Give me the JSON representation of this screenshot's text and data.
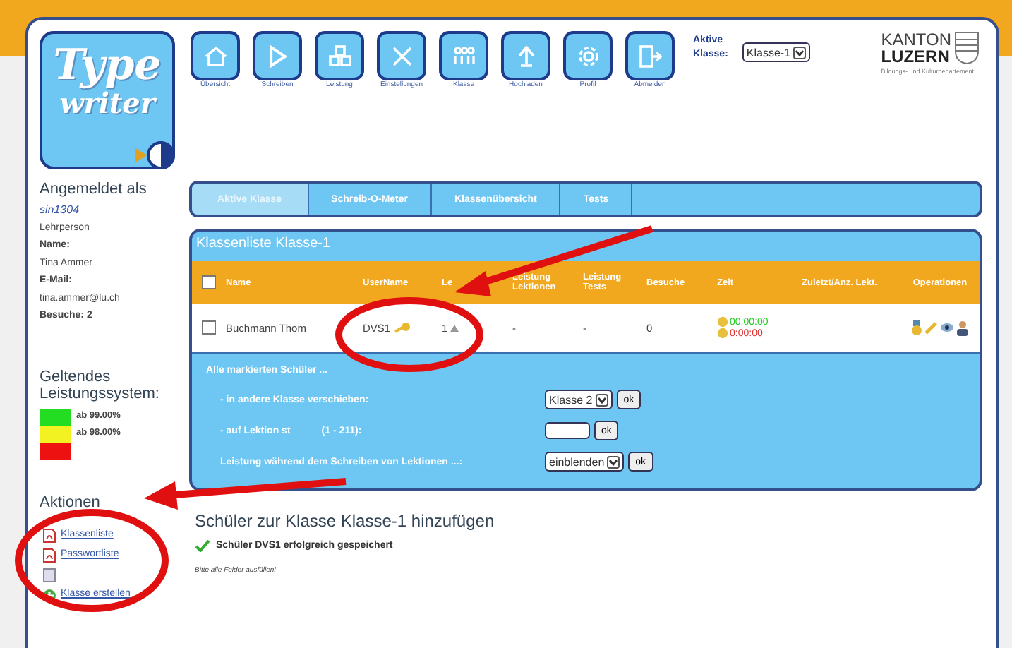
{
  "logo": {
    "line1": "Type",
    "line2": "writer"
  },
  "nav": [
    {
      "label": "Übersicht"
    },
    {
      "label": "Schreiben"
    },
    {
      "label": "Leistung"
    },
    {
      "label": "Einstellungen"
    },
    {
      "label": "Klasse"
    },
    {
      "label": "Hochladen"
    },
    {
      "label": "Profil"
    },
    {
      "label": "Abmelden"
    }
  ],
  "active_class": {
    "label_1": "Aktive",
    "label_2": "Klasse:",
    "value": "Klasse-1"
  },
  "brand": {
    "line1": "KANTON",
    "line2": "LUZERN",
    "subtitle": "Bildungs- und Kulturdepartement"
  },
  "sidebar": {
    "heading": "Angemeldet als",
    "user": "sin1304",
    "role": "Lehrperson",
    "name_label": "Name:",
    "name": "Tina Ammer",
    "email_label": "E-Mail:",
    "email": "tina.ammer@lu.ch",
    "visits": "Besuche: 2",
    "system_heading": "Geltendes Leistungssystem:",
    "levels": [
      {
        "color": "#22dd22",
        "label": "ab 99.00%"
      },
      {
        "color": "#f2f222",
        "label": "ab 98.00%"
      },
      {
        "color": "#ee1111"
      }
    ],
    "actions_heading": "Aktionen",
    "actions": [
      {
        "kind": "pdf",
        "label": "Klassenliste"
      },
      {
        "kind": "pdf",
        "label": "Passwortliste"
      },
      {
        "kind": "hidden"
      },
      {
        "kind": "add",
        "label": "Klasse erstellen"
      }
    ]
  },
  "tabs": [
    {
      "label": "Aktive Klasse",
      "selected": true
    },
    {
      "label": "Schreib-O-Meter",
      "selected": false
    },
    {
      "label": "Klassenübersicht",
      "selected": false
    },
    {
      "label": "Tests",
      "selected": false
    }
  ],
  "table": {
    "title": "Klassenliste Klasse-1",
    "all_checked": false,
    "columns": [
      "Name",
      "UserName",
      "Le",
      "Leistung Lektionen",
      "Leistung Tests",
      "Besuche",
      "Zeit",
      "Zuletzt/Anz. Lekt.",
      "Operationen"
    ],
    "rows": [
      {
        "checked": false,
        "name": "Buchmann Thom",
        "user": "DVS1",
        "lesson": "1",
        "perf_lessons": "-",
        "perf_tests": "-",
        "visits": "0",
        "time_1": "00:00:00",
        "time_2": "0:00:00"
      }
    ]
  },
  "bulk": {
    "heading": "Alle markierten Schüler ...",
    "move_label": "- in andere Klasse verschieben:",
    "move_value": "Klasse 2",
    "move_ok": "ok",
    "lesson_label_1": "- auf Lektion st",
    "lesson_label_2": "(1 - 211):",
    "lesson_ok": "ok",
    "show_label": "Leistung während dem Schreiben von Lektionen ...:",
    "show_value": "einblenden",
    "show_ok": "ok"
  },
  "add": {
    "heading": "Schüler zur Klasse Klasse-1 hinzufügen",
    "success": "Schüler DVS1 erfolgreich gespeichert",
    "hint": "Bitte alle Felder ausfüllen!"
  }
}
